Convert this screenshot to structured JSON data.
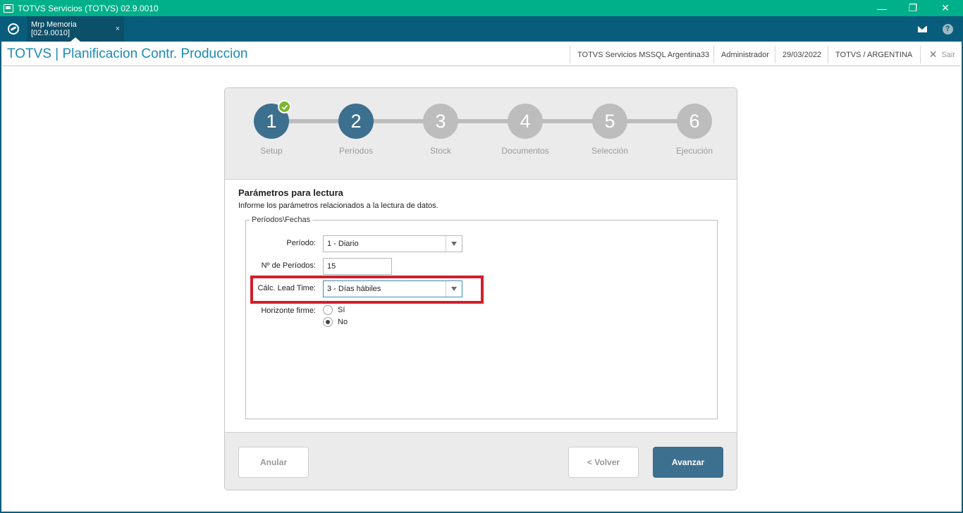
{
  "window": {
    "title": "TOTVS Servicios (TOTVS) 02.9.0010",
    "minimize_glyph": "—",
    "restore_glyph": "❐",
    "close_glyph": "✕"
  },
  "tabs": {
    "items": [
      {
        "label": "Mrp Memoria [02.9.0010]",
        "close_glyph": "×"
      }
    ]
  },
  "header": {
    "title": "TOTVS | Planificacion Contr. Produccion",
    "server": "TOTVS Servicios MSSQL Argentina33",
    "user": "Administrador",
    "date": "29/03/2022",
    "company": "TOTVS / ARGENTINA",
    "exit_label": "Sair"
  },
  "wizard": {
    "steps": [
      {
        "number": "1",
        "label": "Setup",
        "state": "done"
      },
      {
        "number": "2",
        "label": "Períodos",
        "state": "active"
      },
      {
        "number": "3",
        "label": "Stock",
        "state": "pending"
      },
      {
        "number": "4",
        "label": "Documentos",
        "state": "pending"
      },
      {
        "number": "5",
        "label": "Selección",
        "state": "pending"
      },
      {
        "number": "6",
        "label": "Ejecución",
        "state": "pending"
      }
    ],
    "section_title": "Parámetros para lectura",
    "section_desc": "Informe los parámetros relacionados a la lectura de datos.",
    "fieldset_legend": "Períodos\\Fechas",
    "fields": {
      "periodo": {
        "label": "Período:",
        "value": "1 - Diario"
      },
      "num_periodos": {
        "label": "Nº de Períodos:",
        "value": "15"
      },
      "lead_time": {
        "label": "Cálc. Lead Time:",
        "value": "3 - Días hábiles"
      },
      "horizonte": {
        "label": "Horizonte firme:",
        "options": [
          {
            "label": "Sí",
            "checked": false
          },
          {
            "label": "No",
            "checked": true
          }
        ]
      }
    },
    "buttons": {
      "cancel": "Anular",
      "back": "< Volver",
      "next": "Avanzar"
    }
  },
  "colors": {
    "titlebar": "#00b08a",
    "tabbar": "#085d7c",
    "header_title": "#1b8bb2",
    "step_active": "#3d6f8f",
    "step_pending": "#bdbdbd",
    "check": "#7cb82f",
    "highlight": "#d31f2b"
  }
}
